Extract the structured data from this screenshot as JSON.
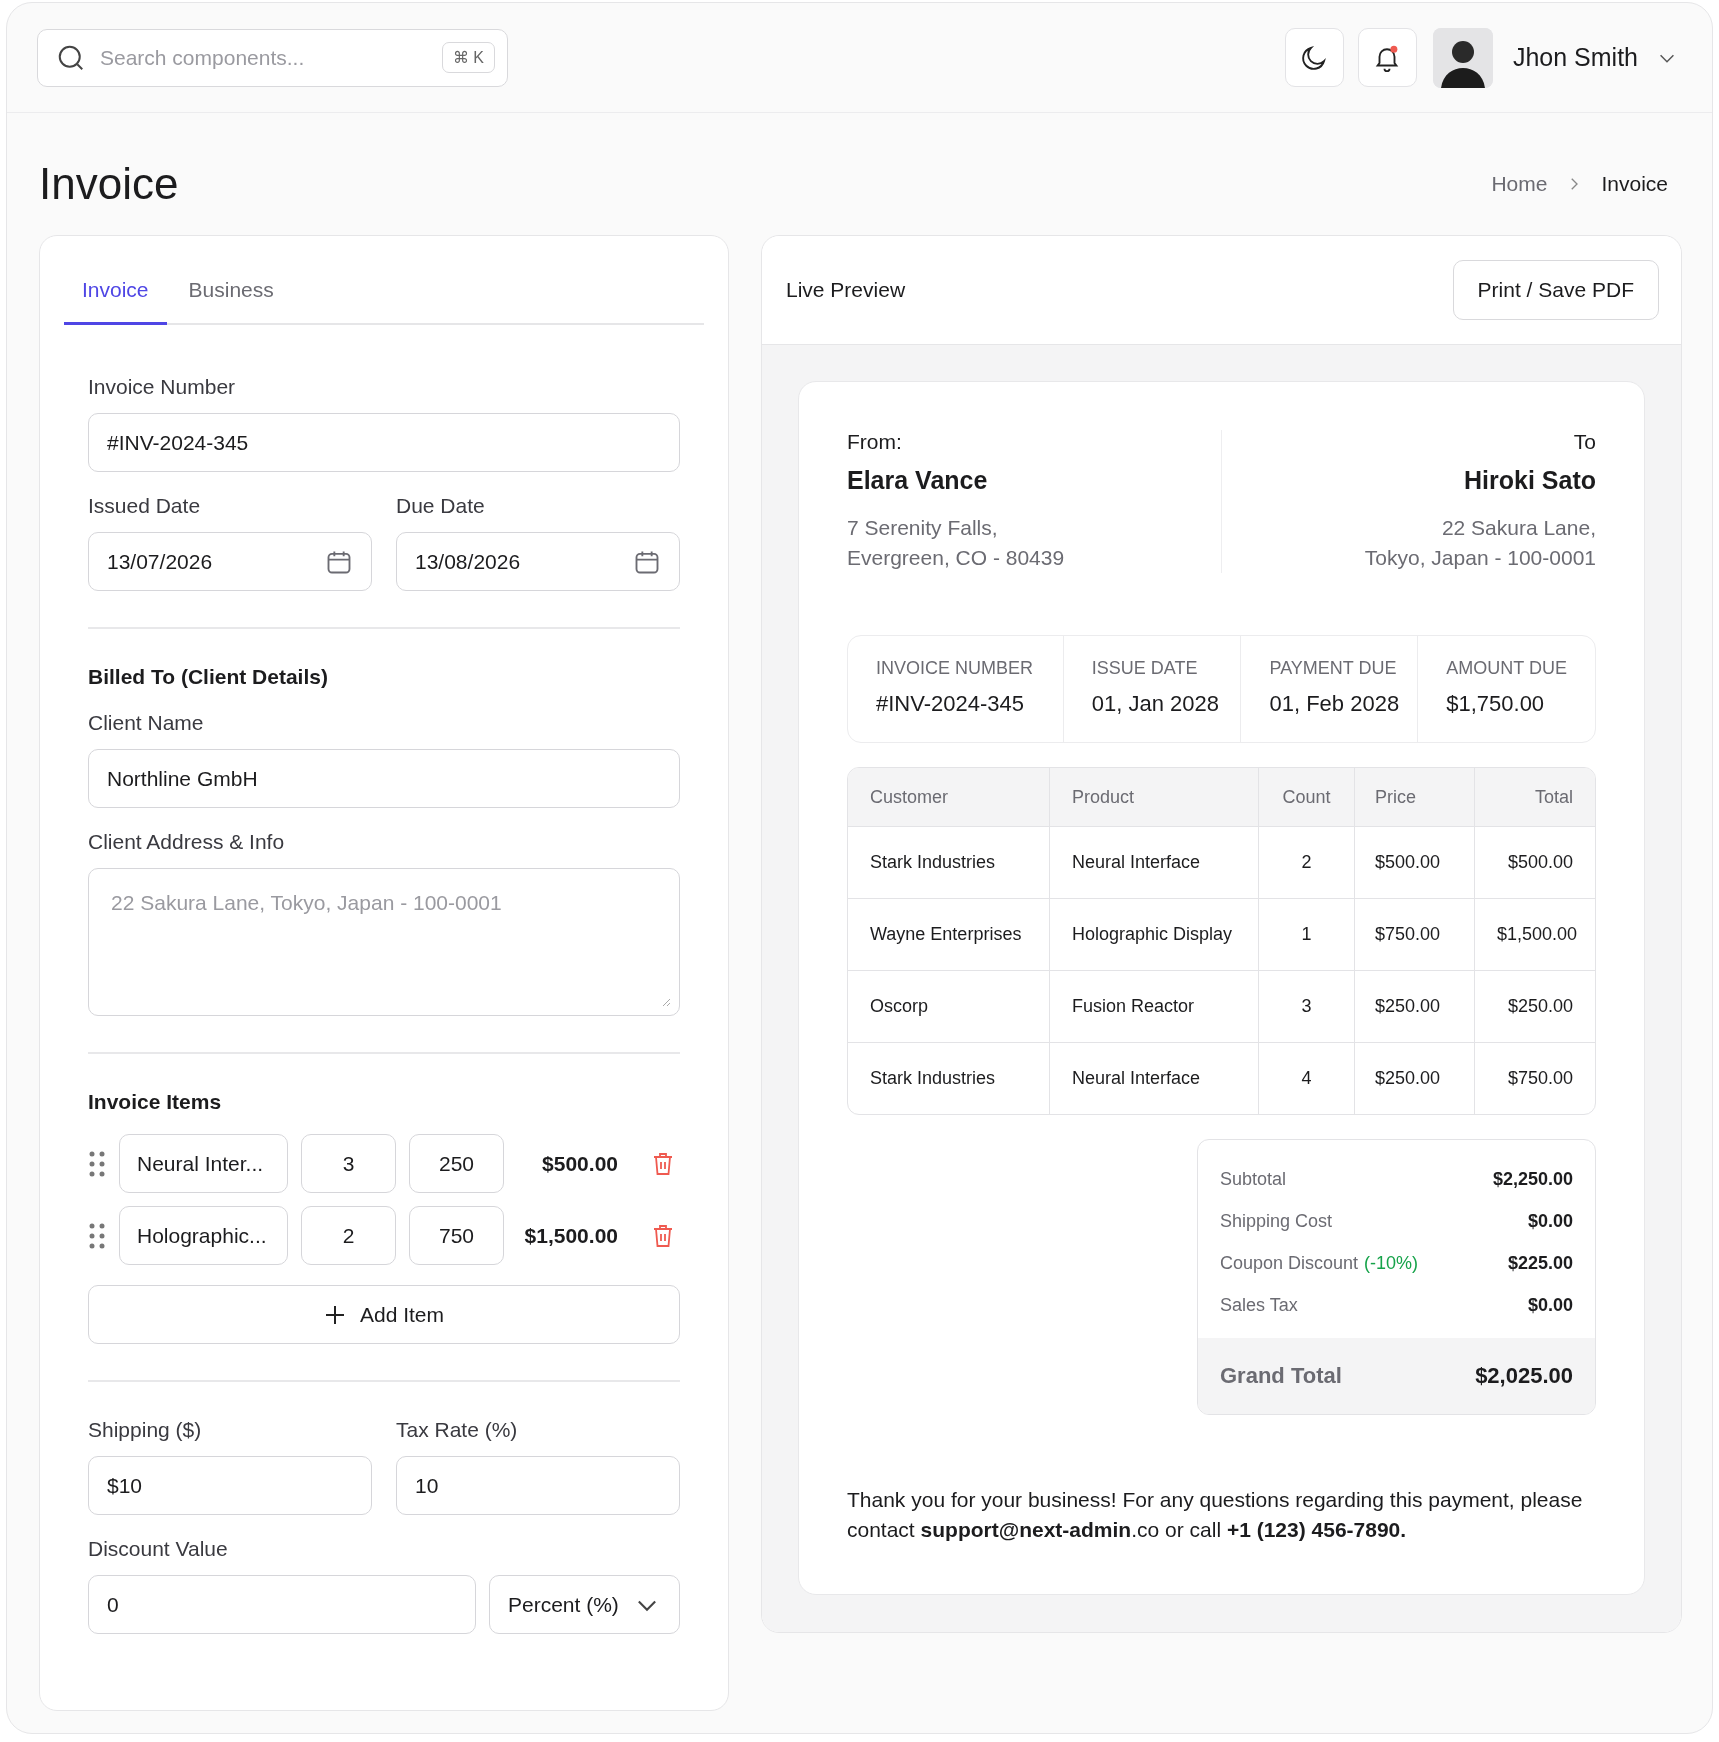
{
  "header": {
    "search": {
      "placeholder": "Search components...",
      "shortcut": "⌘ K"
    },
    "notifications": {
      "unread": true
    },
    "user": {
      "name": "Jhon Smith"
    }
  },
  "page": {
    "title": "Invoice",
    "breadcrumb": [
      {
        "label": "Home",
        "current": false
      },
      {
        "label": "Invoice",
        "current": true
      }
    ]
  },
  "form": {
    "tabs": [
      {
        "label": "Invoice",
        "selected": true
      },
      {
        "label": "Business",
        "selected": false
      }
    ],
    "invoice_number": {
      "label": "Invoice Number",
      "value": "#INV-2024-345"
    },
    "issued_date": {
      "label": "Issued Date",
      "value": "13/07/2026"
    },
    "due_date": {
      "label": "Due Date",
      "value": "13/08/2026"
    },
    "billed_heading": "Billed To (Client Details)",
    "client_name": {
      "label": "Client Name",
      "value": "Northline GmbH"
    },
    "client_address": {
      "label": "Client Address & Info",
      "placeholder": "22 Sakura Lane, Tokyo, Japan - 100-0001"
    },
    "items_heading": "Invoice Items",
    "items": [
      {
        "name": "Neural Inter...",
        "qty": "3",
        "price": "250",
        "total": "$500.00"
      },
      {
        "name": "Holographic...",
        "qty": "2",
        "price": "750",
        "total": "$1,500.00"
      }
    ],
    "add_item": "Add Item",
    "shipping": {
      "label": "Shipping ($)",
      "value": "$10"
    },
    "tax_rate": {
      "label": "Tax Rate (%)",
      "value": "10"
    },
    "discount": {
      "label": "Discount Value",
      "value": "0",
      "type": "Percent (%)"
    }
  },
  "preview": {
    "title": "Live Preview",
    "print_button": "Print / Save PDF",
    "from": {
      "label": "From:",
      "name": "Elara Vance",
      "address": [
        "7 Serenity Falls,",
        "Evergreen, CO - 80439"
      ]
    },
    "to": {
      "label": "To",
      "name": "Hiroki Sato",
      "address": [
        "22 Sakura Lane,",
        "Tokyo, Japan - 100-0001"
      ]
    },
    "meta": [
      {
        "label": "INVOICE NUMBER",
        "value": "#INV-2024-345"
      },
      {
        "label": "ISSUE DATE",
        "value": "01, Jan 2028"
      },
      {
        "label": "PAYMENT DUE",
        "value": "01, Feb 2028"
      },
      {
        "label": "AMOUNT DUE",
        "value": "$1,750.00"
      }
    ],
    "table": {
      "columns": [
        "Customer",
        "Product",
        "Count",
        "Price",
        "Total"
      ],
      "rows": [
        [
          "Stark Industries",
          "Neural Interface",
          "2",
          "$500.00",
          "$500.00"
        ],
        [
          "Wayne Enterprises",
          "Holographic Display",
          "1",
          "$750.00",
          "$1,500.00"
        ],
        [
          "Oscorp",
          "Fusion Reactor",
          "3",
          "$250.00",
          "$250.00"
        ],
        [
          "Stark Industries",
          "Neural Interface",
          "4",
          "$250.00",
          "$750.00"
        ]
      ]
    },
    "totals": [
      {
        "label": "Subtotal",
        "value": "$2,250.00"
      },
      {
        "label": "Shipping Cost",
        "value": "$0.00"
      },
      {
        "label": "Coupon Discount",
        "note": "(-10%)",
        "value": "$225.00"
      },
      {
        "label": "Sales Tax",
        "value": "$0.00"
      }
    ],
    "grand_total": {
      "label": "Grand Total",
      "value": "$2,025.00"
    },
    "note": "Thank you for your business! For any questions regarding this payment, please contact **support@next-admin**.co or call **+1 (123) 456-7890.**"
  }
}
